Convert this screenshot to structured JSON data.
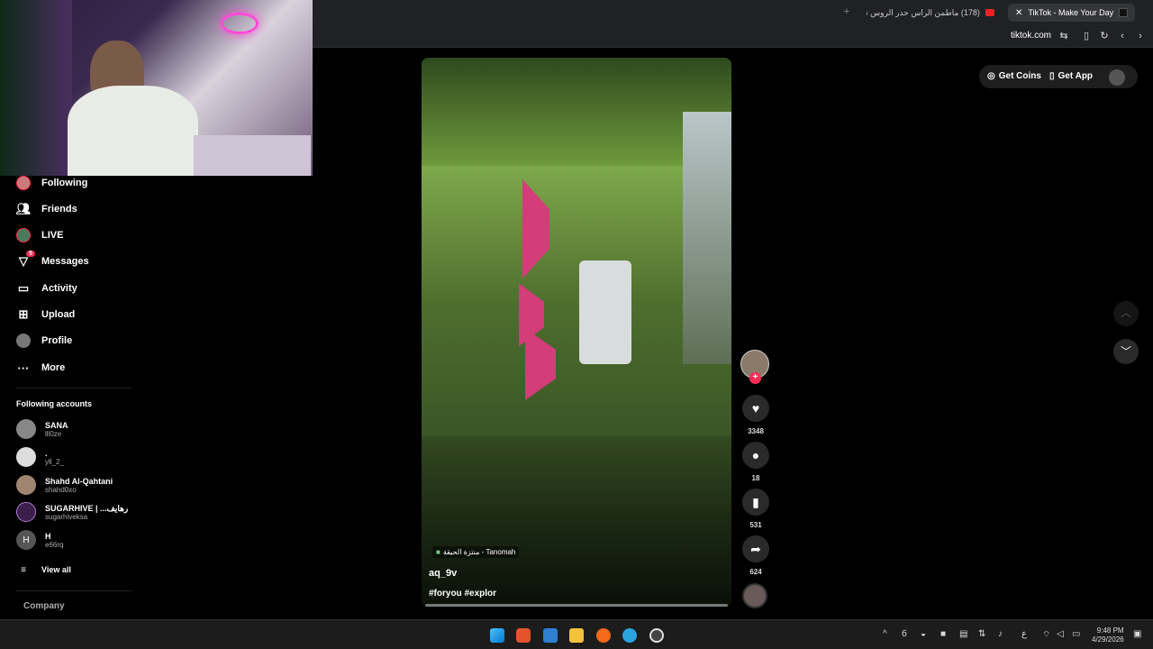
{
  "browser": {
    "tabs": [
      {
        "label": "(178) ماطمن الراس حدر الروس ترعل ."
      },
      {
        "label": "TikTok - Make Your Day"
      }
    ],
    "address": "tiktok.com"
  },
  "sidebar": {
    "items": [
      {
        "label": "Following"
      },
      {
        "label": "Friends"
      },
      {
        "label": "LIVE"
      },
      {
        "label": "Messages",
        "badge": "5"
      },
      {
        "label": "Activity"
      },
      {
        "label": "Upload"
      },
      {
        "label": "Profile"
      },
      {
        "label": "More"
      }
    ],
    "following_header": "Following accounts",
    "accounts": [
      {
        "name": "SANA",
        "handle": "lll0ze"
      },
      {
        "name": ".",
        "handle": "yll_2_"
      },
      {
        "name": "Shahd Al-Qahtani",
        "handle": "shahd0xo"
      },
      {
        "name": "SUGARHIVE | ...رهايف",
        "handle": "sugarhiveksa"
      },
      {
        "name": "H",
        "handle": "e66rq",
        "initial": "H"
      }
    ],
    "view_all": "View all",
    "company": "Company"
  },
  "topbar": {
    "get_coins": "Get Coins",
    "get_app": "Get App"
  },
  "video": {
    "location": "منتزة الحيقة - Tanomah",
    "author": "aq_9v",
    "hashtags": "#foryou #explor"
  },
  "actions": {
    "likes": "3348",
    "comments": "18",
    "saves": "531",
    "shares": "624"
  },
  "taskbar": {
    "time": "9:48 PM",
    "date": "4/29/2026",
    "lang": "ع"
  },
  "colors": {
    "accent": "#fe2c55",
    "tab_active": "#35363a",
    "chrome_bg": "#202124"
  }
}
